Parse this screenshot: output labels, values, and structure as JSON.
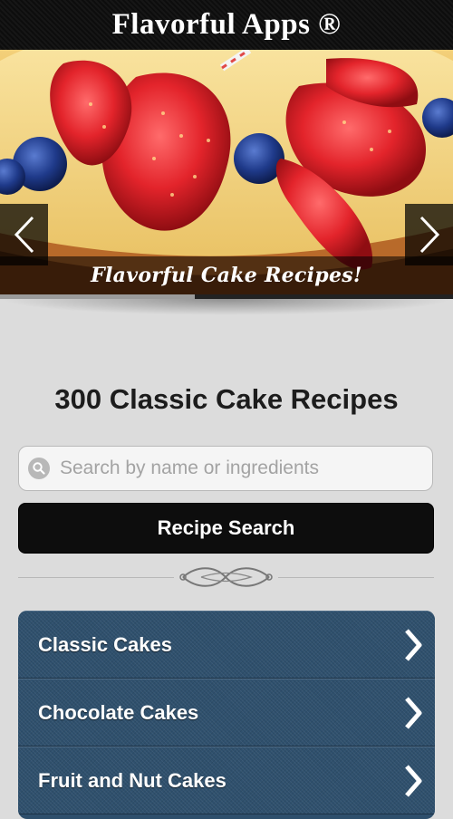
{
  "header": {
    "title": "Flavorful Apps ®"
  },
  "slider": {
    "caption": "Flavorful Cake Recipes!",
    "progress": 0.43
  },
  "main": {
    "title": "300 Classic Cake Recipes",
    "search": {
      "placeholder": "Search by name or ingredients",
      "value": ""
    },
    "search_button": "Recipe Search"
  },
  "categories": [
    {
      "label": "Classic Cakes"
    },
    {
      "label": "Chocolate Cakes"
    },
    {
      "label": "Fruit and Nut Cakes"
    }
  ],
  "colors": {
    "header_bg": "#0d0d0d",
    "menu_bg": "#2f506d",
    "page_bg": "#dcdcdc"
  },
  "icons": [
    "chevron-left-icon",
    "chevron-right-icon",
    "search-icon",
    "flourish-divider-icon"
  ]
}
